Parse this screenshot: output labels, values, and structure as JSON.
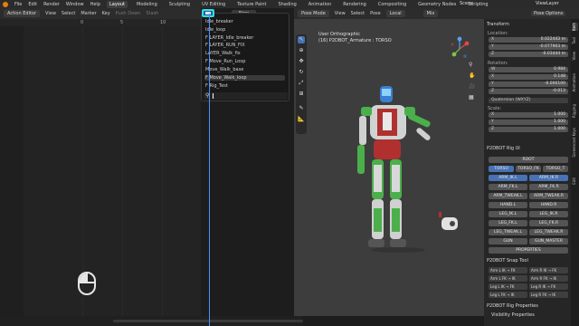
{
  "menu": {
    "items": [
      "File",
      "Edit",
      "Render",
      "Window",
      "Help"
    ],
    "workspaces": [
      "Layout",
      "Modeling",
      "Sculpting",
      "UV Editing",
      "Texture Paint",
      "Shading",
      "Animation",
      "Rendering",
      "Compositing",
      "Geometry Nodes",
      "Scripting"
    ],
    "active_workspace": "Layout",
    "scene": "Scene",
    "view_layer": "ViewLayer"
  },
  "left_editor": {
    "editor_type": "Action Editor",
    "menus": [
      "View",
      "Select",
      "Marker",
      "Key"
    ],
    "push_down": "Push Down",
    "stash": "Stash",
    "new_button": "New",
    "ruler_ticks": [
      "0",
      "5",
      "10"
    ]
  },
  "action_menu": {
    "items": [
      "Idle_breaker",
      "Idle_loop",
      "F LAYER_Idle_breaker",
      "F LAYER_RUN_FIX",
      "LAYER_Walk_fix",
      "F Move_Run_Loop",
      "Move_Walk_base",
      "F Move_Walk_loop",
      "F Rig_Test"
    ],
    "highlighted": "F Move_Walk_loop",
    "search_icon": "search-icon"
  },
  "viewport": {
    "mode": "Pose Mode",
    "menus": [
      "View",
      "Select",
      "Pose"
    ],
    "orientation": "Local",
    "info_line1": "User Orthographic",
    "info_line2": "(16) P2DBOT_Armature : TORSO",
    "pivot": "Mix"
  },
  "properties": {
    "pose_options": "Pose Options",
    "transform_header": "Transform",
    "location_label": "Location:",
    "location": [
      {
        "k": "X",
        "v": "0.022443 m"
      },
      {
        "k": "Y",
        "v": "-0.077903 m"
      },
      {
        "k": "Z",
        "v": "-0.03444 m"
      }
    ],
    "rotation_label": "Rotation:",
    "rotation": [
      {
        "k": "W",
        "v": "0.984"
      },
      {
        "k": "X",
        "v": "0.148"
      },
      {
        "k": "Y",
        "v": "-0.000100"
      },
      {
        "k": "Z",
        "v": "-0.013"
      }
    ],
    "rotation_mode": "Quaternion (WXYZ)",
    "scale_label": "Scale:",
    "scale": [
      {
        "k": "X",
        "v": "1.000"
      },
      {
        "k": "Y",
        "v": "1.000"
      },
      {
        "k": "Z",
        "v": "1.000"
      }
    ],
    "rig_ui_header": "P2DBOT Rig UI",
    "rig_rows": [
      [
        "ROOT"
      ],
      [
        "TORSO",
        "TORSO_FK",
        "TORSO_T"
      ],
      [
        "ARM_IK.L",
        "ARM_IK.R"
      ],
      [
        "ARM_FK.L",
        "ARM_FK.R"
      ],
      [
        "ARM_TWEAK.L",
        "ARM_TWEAK.R"
      ],
      [
        "HAND.L",
        "HAND.R"
      ],
      [
        "LEG_IK.L",
        "LEG_IK.R"
      ],
      [
        "LEG_FK.L",
        "LEG_FK.R"
      ],
      [
        "LEG_TWEAK.L",
        "LEG_TWEAK.R"
      ],
      [
        "GUN",
        "GUN_MASTER"
      ],
      [
        "PROPERTIES"
      ]
    ],
    "blue_buttons": [
      "TORSO",
      "ARM_IK.L",
      "ARM_IK.R"
    ],
    "snap_header": "P2DBOT Snap Tool",
    "snap_rows": [
      [
        "Arm L IK → FK",
        "Arm R IK → FK"
      ],
      [
        "Arm L FK → IK",
        "Arm R FK → IK"
      ],
      [
        "Leg L IK → FK",
        "Leg R IK → FK"
      ],
      [
        "Leg L FK → IK",
        "Leg R FK → IK"
      ]
    ],
    "rig_props_header": "P2DBOT Rig Properties",
    "visibility_header": "Visibility Properties"
  },
  "side_tabs": [
    "Item",
    "Tool",
    "View",
    "Animation",
    "Rigging",
    "Screencast Keys",
    "Edit"
  ],
  "active_side_tab": "Item",
  "colors": {
    "accent_blue": "#4772b3",
    "highlight_cyan": "#2de0e6",
    "playhead": "#4a90ff"
  }
}
